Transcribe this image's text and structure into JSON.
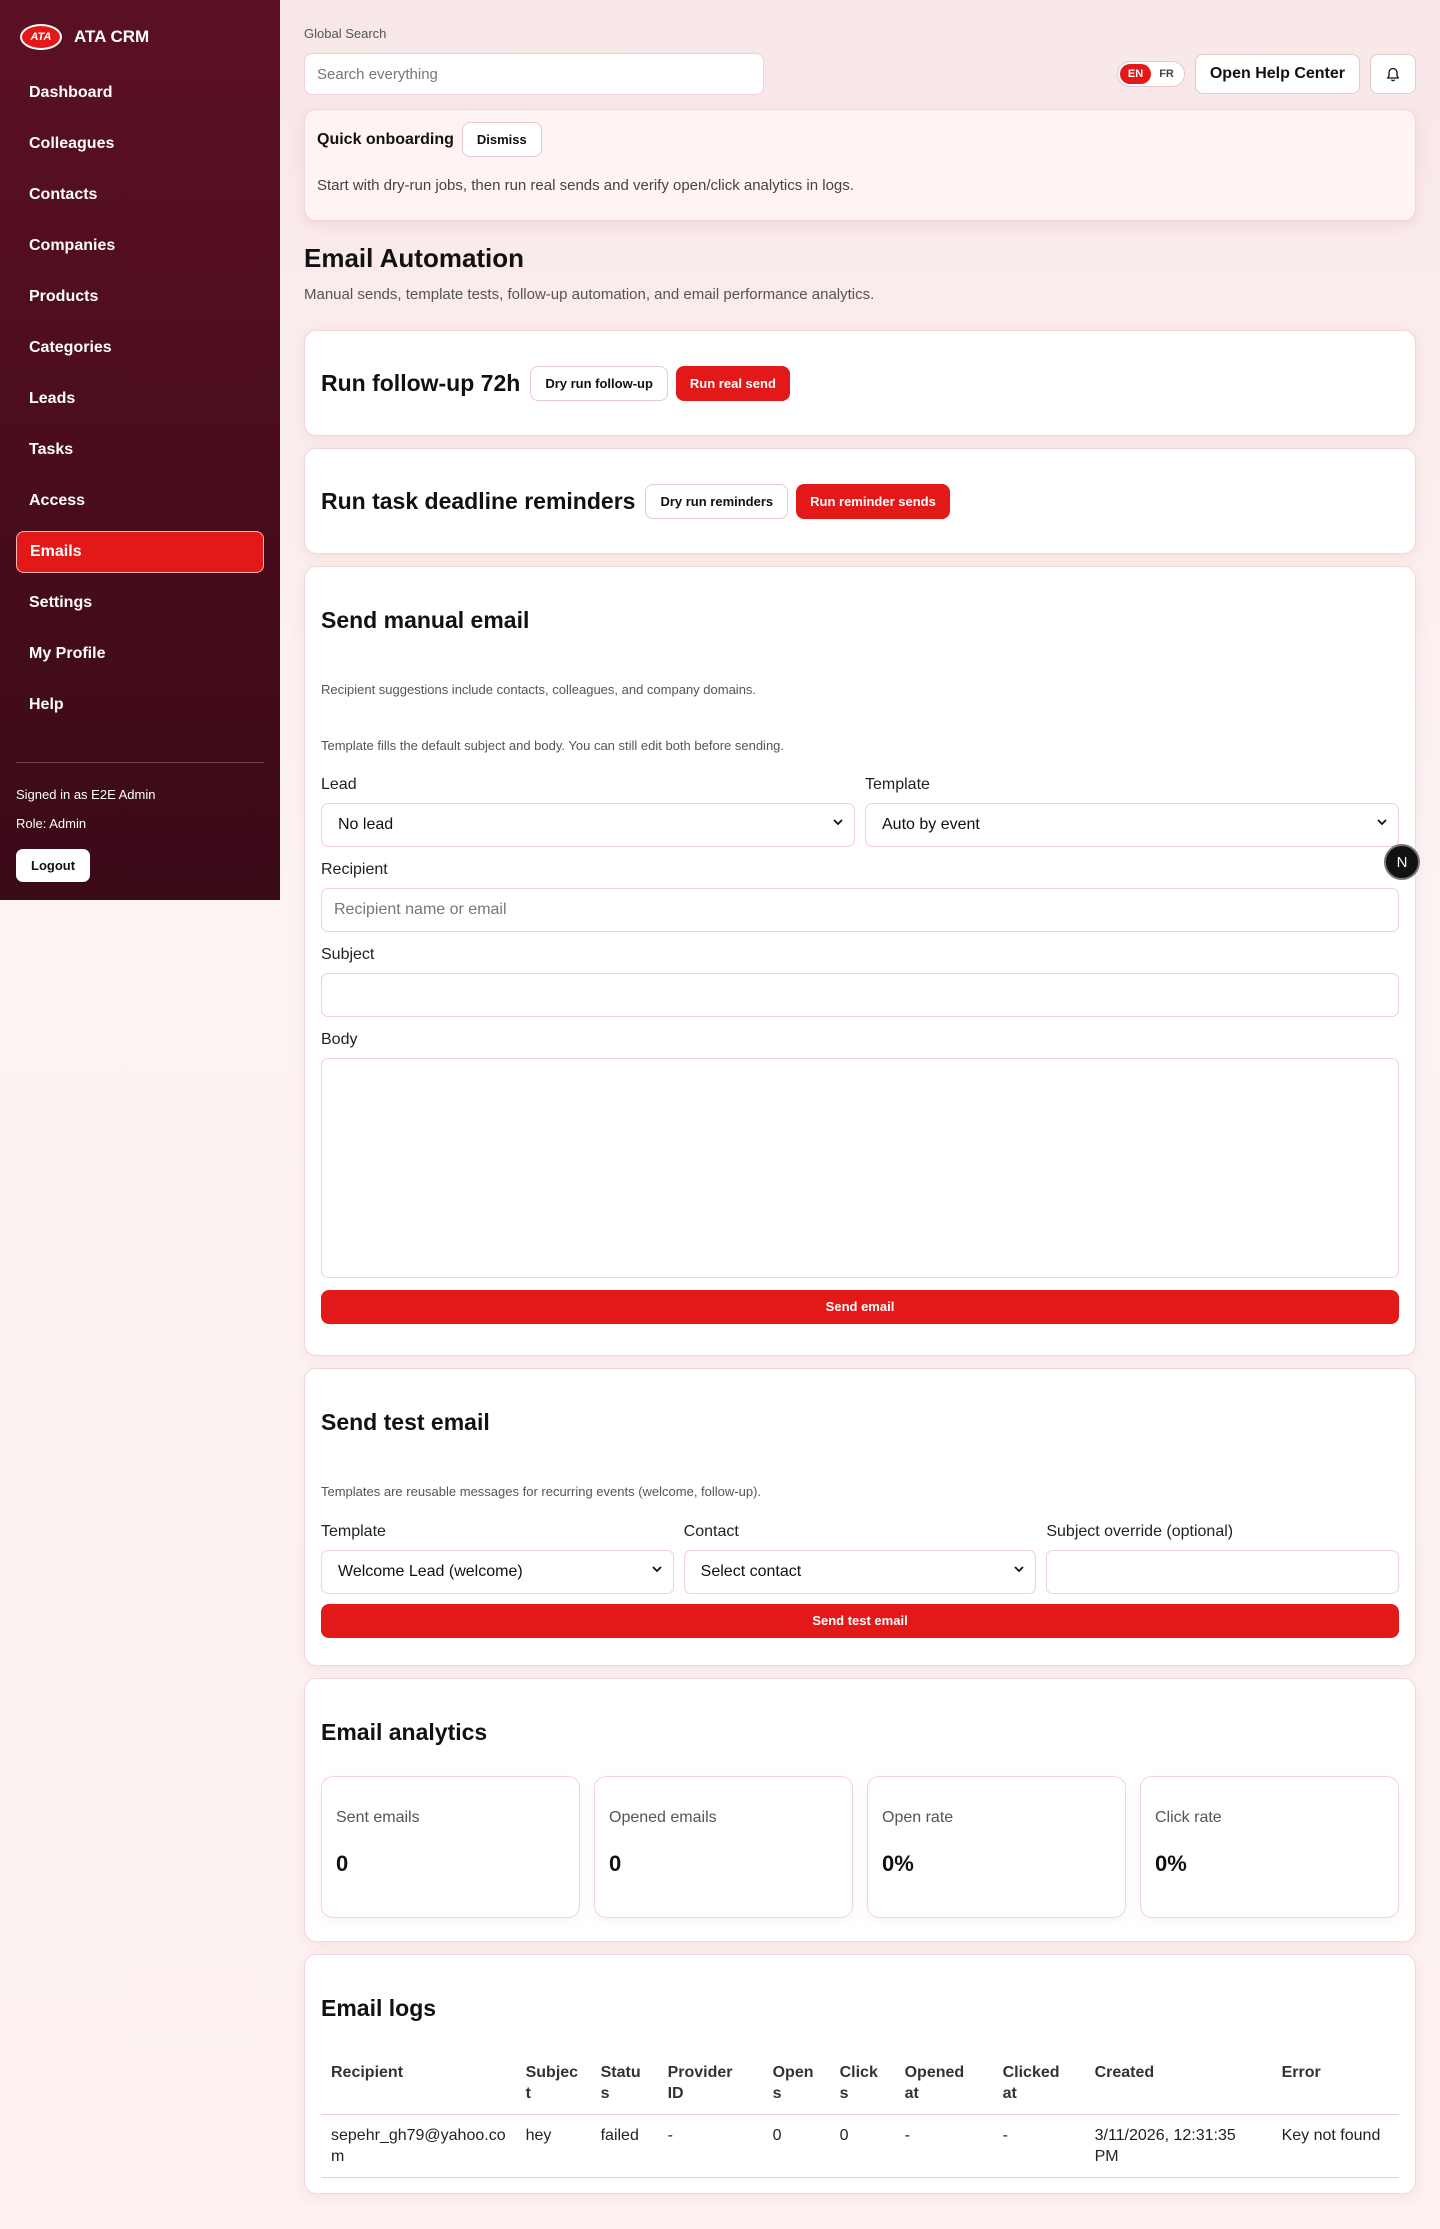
{
  "brand": {
    "logo": "ATA",
    "name": "ATA CRM"
  },
  "sidebar": {
    "items": [
      {
        "label": "Dashboard"
      },
      {
        "label": "Colleagues"
      },
      {
        "label": "Contacts"
      },
      {
        "label": "Companies"
      },
      {
        "label": "Products"
      },
      {
        "label": "Categories"
      },
      {
        "label": "Leads"
      },
      {
        "label": "Tasks"
      },
      {
        "label": "Access"
      },
      {
        "label": "Emails",
        "active": true
      },
      {
        "label": "Settings"
      },
      {
        "label": "My Profile"
      },
      {
        "label": "Help"
      }
    ],
    "signed_in": "Signed in as E2E Admin",
    "role": "Role: Admin",
    "logout": "Logout"
  },
  "header": {
    "search_label": "Global Search",
    "search_placeholder": "Search everything",
    "lang": {
      "en": "EN",
      "fr": "FR"
    },
    "help_button": "Open Help Center"
  },
  "onboarding": {
    "title": "Quick onboarding",
    "dismiss": "Dismiss",
    "text": "Start with dry-run jobs, then run real sends and verify open/click analytics in logs."
  },
  "page": {
    "title": "Email Automation",
    "subtitle": "Manual sends, template tests, follow-up automation, and email performance analytics."
  },
  "followup": {
    "title": "Run follow-up 72h",
    "dry": "Dry run follow-up",
    "real": "Run real send"
  },
  "reminders": {
    "title": "Run task deadline reminders",
    "dry": "Dry run reminders",
    "real": "Run reminder sends"
  },
  "manual": {
    "title": "Send manual email",
    "hint1": "Recipient suggestions include contacts, colleagues, and company domains.",
    "hint2": "Template fills the default subject and body. You can still edit both before sending.",
    "lead_label": "Lead",
    "lead_value": "No lead",
    "template_label": "Template",
    "template_value": "Auto by event",
    "recipient_label": "Recipient",
    "recipient_placeholder": "Recipient name or email",
    "subject_label": "Subject",
    "body_label": "Body",
    "send": "Send email"
  },
  "test": {
    "title": "Send test email",
    "hint": "Templates are reusable messages for recurring events (welcome, follow-up).",
    "template_label": "Template",
    "template_value": "Welcome Lead (welcome)",
    "contact_label": "Contact",
    "contact_value": "Select contact",
    "subject_label": "Subject override (optional)",
    "send": "Send test email"
  },
  "analytics": {
    "title": "Email analytics",
    "stats": [
      {
        "label": "Sent emails",
        "value": "0"
      },
      {
        "label": "Opened emails",
        "value": "0"
      },
      {
        "label": "Open rate",
        "value": "0%"
      },
      {
        "label": "Click rate",
        "value": "0%"
      }
    ]
  },
  "logs": {
    "title": "Email logs",
    "columns": [
      "Recipient",
      "Subjec t",
      "Statu s",
      "Provider ID",
      "Open s",
      "Click s",
      "Opened at",
      "Clicked at",
      "Created",
      "Error"
    ],
    "rows": [
      [
        "sepehr_gh79@yahoo.co m",
        "hey",
        "failed",
        "-",
        "0",
        "0",
        "-",
        "-",
        "3/11/2026, 12:31:35 PM",
        "Key not found"
      ]
    ]
  },
  "floating_badge": "N"
}
